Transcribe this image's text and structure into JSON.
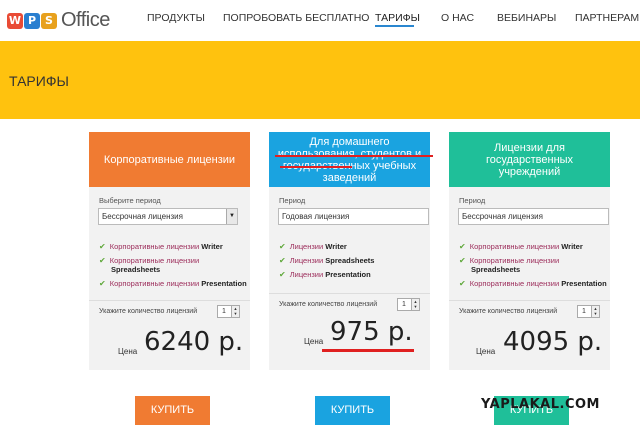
{
  "header": {
    "logo_text": "Office",
    "logo_letters": [
      "W",
      "P",
      "S"
    ],
    "nav": [
      {
        "label": "ПРОДУКТЫ"
      },
      {
        "label": "ПОПРОБОВАТЬ БЕСПЛАТНО"
      },
      {
        "label": "ТАРИФЫ",
        "active": true
      },
      {
        "label": "О НАС"
      },
      {
        "label": "ВЕБИНАРЫ"
      },
      {
        "label": "ПАРТНЕРАМ"
      }
    ]
  },
  "banner": {
    "title": "ТАРИФЫ",
    "color": "#ffc20e"
  },
  "cards": [
    {
      "title": "Корпоративные лицензии",
      "color": "#f07b32",
      "period_label": "Выберите период",
      "period_value": "Бессрочная лицензия",
      "features": [
        {
          "prefix": "Корпоративные лицензии",
          "app": "Writer"
        },
        {
          "prefix": "Корпоративные лицензии",
          "app": "Spreadsheets"
        },
        {
          "prefix": "Корпоративные лицензии",
          "app": "Presentation"
        }
      ],
      "qty_label": "Укажите количество лицензий",
      "qty_value": "1",
      "price_label": "Цена",
      "price_value": "6240 р.",
      "buy_label": "КУПИТЬ",
      "buy_color": "#f07b32"
    },
    {
      "title": "Для домашнего использования, студентов и государственных учебных заведений",
      "color": "#1aa3e0",
      "period_label": "Период",
      "period_value": "Годовая лицензия",
      "features": [
        {
          "prefix": "Лицензии",
          "app": "Writer"
        },
        {
          "prefix": "Лицензии",
          "app": "Spreadsheets"
        },
        {
          "prefix": "Лицензии",
          "app": "Presentation"
        }
      ],
      "qty_label": "Укажите количество лицензий",
      "qty_value": "1",
      "price_label": "Цена",
      "price_value": "975 р.",
      "buy_label": "КУПИТЬ",
      "buy_color": "#1aa3e0"
    },
    {
      "title": "Лицензии для государственных учреждений",
      "color": "#1fbf99",
      "period_label": "Период",
      "period_value": "Бессрочная лицензия",
      "features": [
        {
          "prefix": "Корпоративные лицензии",
          "app": "Writer"
        },
        {
          "prefix": "Корпоративные лицензии",
          "app": "Spreadsheets"
        },
        {
          "prefix": "Корпоративные лицензии",
          "app": "Presentation"
        }
      ],
      "qty_label": "Укажите количество лицензий",
      "qty_value": "1",
      "price_label": "Цена",
      "price_value": "4095 р.",
      "buy_label": "КУПИТЬ",
      "buy_color": "#1fbf99"
    }
  ],
  "watermark": "YAPLAKAL.COM"
}
